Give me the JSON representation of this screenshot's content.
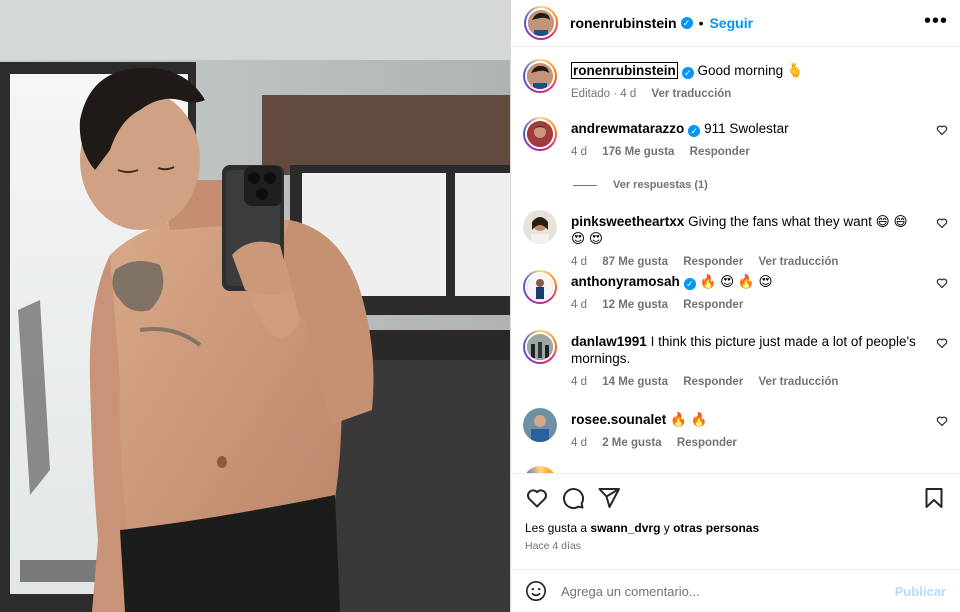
{
  "header": {
    "username": "ronenrubinstein",
    "separator": "•",
    "follow_label": "Seguir",
    "more_label": "•••"
  },
  "caption": {
    "username": "ronenrubinstein",
    "text": "Good morning 🫰",
    "edited": "Editado · 4 d",
    "translate": "Ver traducción"
  },
  "comments": [
    {
      "username": "andrewmatarazzo",
      "verified": true,
      "text": "911 Swolestar",
      "time": "4 d",
      "likes": "176 Me gusta",
      "reply": "Responder",
      "translate": ""
    },
    {
      "username": "pinksweetheartxx",
      "verified": false,
      "text": "Giving the fans what they want 😄 😄 😍 😍",
      "time": "4 d",
      "likes": "87 Me gusta",
      "reply": "Responder",
      "translate": "Ver traducción"
    },
    {
      "username": "anthonyramosah",
      "verified": true,
      "text": "🔥 😍 🔥 😍",
      "time": "4 d",
      "likes": "12 Me gusta",
      "reply": "Responder",
      "translate": ""
    },
    {
      "username": "danlaw1991",
      "verified": false,
      "text": "I think this picture just made a lot of people's mornings.",
      "time": "4 d",
      "likes": "14 Me gusta",
      "reply": "Responder",
      "translate": "Ver traducción"
    },
    {
      "username": "rosee.sounalet",
      "verified": false,
      "text": "🔥 🔥",
      "time": "4 d",
      "likes": "2 Me gusta",
      "reply": "Responder",
      "translate": ""
    }
  ],
  "view_replies": "Ver respuestas (1)",
  "likes": {
    "prefix": "Les gusta a ",
    "user": "swann_dvrg",
    "middle": " y ",
    "others": "otras personas"
  },
  "time_ago": "Hace 4 días",
  "add_comment": {
    "placeholder": "Agrega un comentario...",
    "publish": "Publicar"
  },
  "colors": {
    "accent": "#0095f6",
    "muted": "#737373",
    "publish_disabled": "#b3dbff"
  },
  "icons": [
    "heart-icon",
    "comment-icon",
    "share-icon",
    "bookmark-icon",
    "emoji-icon",
    "more-icon",
    "verified-icon"
  ]
}
